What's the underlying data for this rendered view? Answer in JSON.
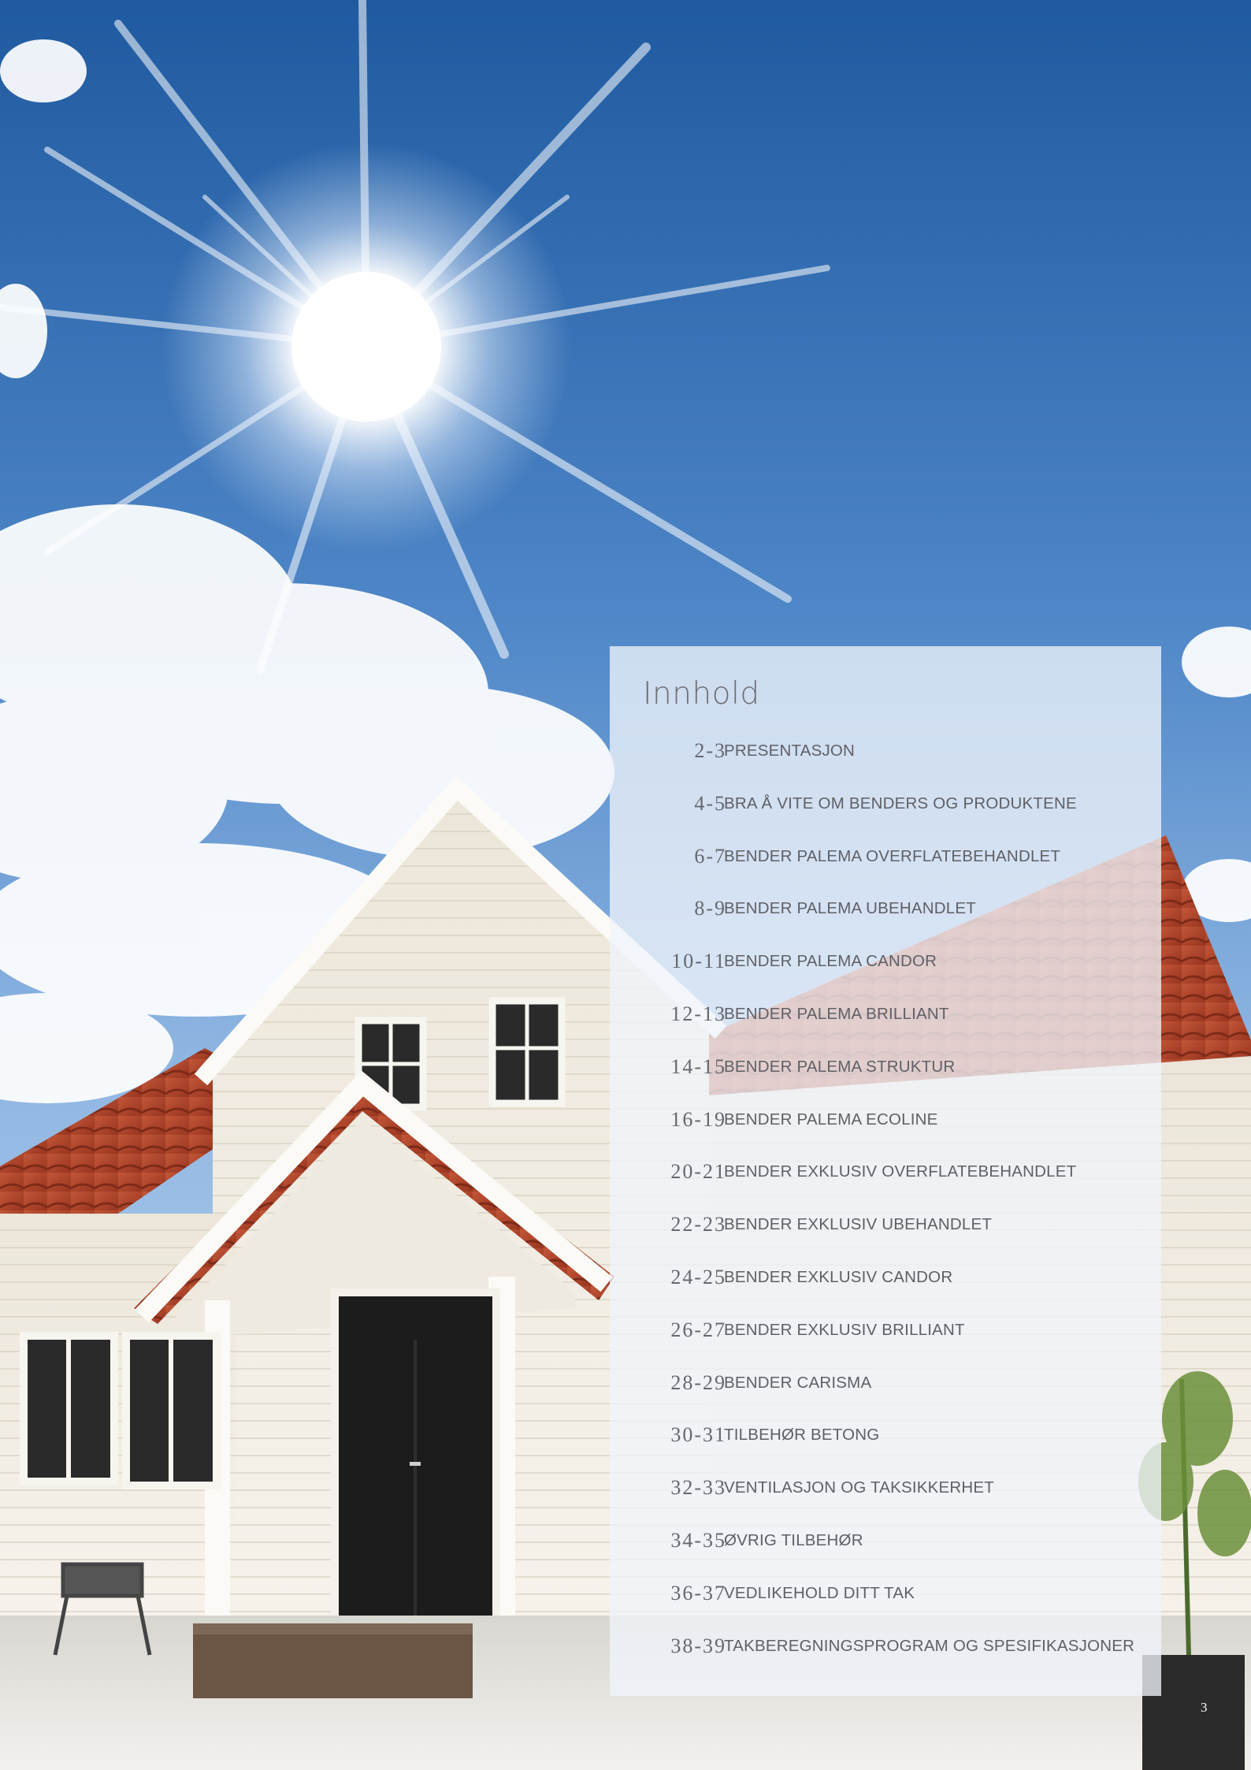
{
  "toc": {
    "title": "Innhold",
    "entries": [
      {
        "pages": "2-3",
        "label": "PRESENTASJON"
      },
      {
        "pages": "4-5",
        "label": "BRA Å VITE OM BENDERS OG PRODUKTENE"
      },
      {
        "pages": "6-7",
        "label": "BENDER PALEMA OVERFLATEBEHANDLET"
      },
      {
        "pages": "8-9",
        "label": "BENDER PALEMA UBEHANDLET"
      },
      {
        "pages": "10-11",
        "label": "BENDER PALEMA CANDOR"
      },
      {
        "pages": "12-13",
        "label": "BENDER PALEMA BRILLIANT"
      },
      {
        "pages": "14-15",
        "label": "BENDER PALEMA STRUKTUR"
      },
      {
        "pages": "16-19",
        "label": "BENDER PALEMA ECOLINE"
      },
      {
        "pages": "20-21",
        "label": "BENDER EXKLUSIV OVERFLATEBEHANDLET"
      },
      {
        "pages": "22-23",
        "label": "BENDER EXKLUSIV UBEHANDLET"
      },
      {
        "pages": "24-25",
        "label": "BENDER EXKLUSIV CANDOR"
      },
      {
        "pages": "26-27",
        "label": "BENDER EXKLUSIV BRILLIANT"
      },
      {
        "pages": "28-29",
        "label": "BENDER CARISMA"
      },
      {
        "pages": "30-31",
        "label": "TILBEHØR BETONG"
      },
      {
        "pages": "32-33",
        "label": "VENTILASJON OG TAKSIKKERHET"
      },
      {
        "pages": "34-35",
        "label": "ØVRIG TILBEHØR"
      },
      {
        "pages": "36-37",
        "label": "VEDLIKEHOLD DITT TAK"
      },
      {
        "pages": "38-39",
        "label": "TAKBEREGNINGSPROGRAM OG SPESIFIKASJONER"
      }
    ]
  },
  "page_number": "3",
  "colors": {
    "sky_top": "#1e5a9e",
    "sky_bottom": "#8fb6e0",
    "roof": "#b9492e",
    "house_wall": "#f3efe6",
    "text": "#5f6066"
  }
}
